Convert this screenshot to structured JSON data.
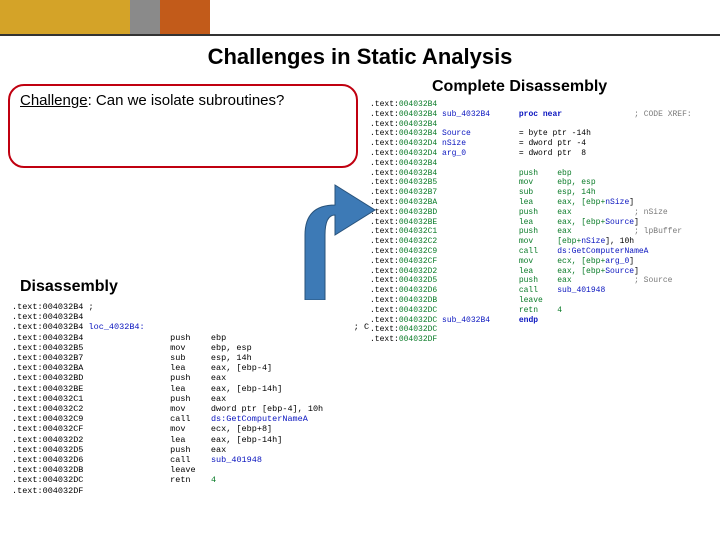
{
  "title": "Challenges in Static Analysis",
  "challenge_prefix": "Challenge",
  "challenge_rest": ": Can we isolate subroutines?",
  "right_heading": "Complete Disassembly",
  "left_heading": "Disassembly",
  "code_left": {
    "l01": ".text:004032B4 ;",
    "l02": ".text:004032B4",
    "l03a": ".text:004032B4 ",
    "l03b": "loc_4032B4:",
    "l03c": "                                         ; C",
    "l04": ".text:004032B4                 push    ebp",
    "l05": ".text:004032B5                 mov     ebp, esp",
    "l06": ".text:004032B7                 sub     esp, 14h",
    "l07": ".text:004032BA                 lea     eax, [ebp-4]",
    "l08": ".text:004032BD                 push    eax",
    "l09": ".text:004032BE                 lea     eax, [ebp-14h]",
    "l10": ".text:004032C1                 push    eax",
    "l11": ".text:004032C2                 mov     dword ptr [ebp-4], 10h",
    "l12a": ".text:004032C9                 call    ",
    "l12b": "ds:GetComputerNameA",
    "l13": ".text:004032CF                 mov     ecx, [ebp+8]",
    "l14": ".text:004032D2                 lea     eax, [ebp-14h]",
    "l15": ".text:004032D5                 push    eax",
    "l16a": ".text:004032D6                 call    ",
    "l16b": "sub_401948",
    "l17": ".text:004032DB                 leave",
    "l18a": ".text:004032DC                 retn    ",
    "l18b": "4",
    "l19": ".text:004032DF"
  },
  "code_right": {
    "l01a": ".text:",
    "l01b": "004032B4",
    "l02a": ".text:",
    "l02b": "004032B4 ",
    "l02c": "sub_4032B4",
    "l02d": "      ",
    "l02e": "proc near",
    "l02f": "               ",
    "l02g": "; CODE XREF:",
    "l03a": ".text:",
    "l03b": "004032B4",
    "l04a": ".text:",
    "l04b": "004032B4 ",
    "l04c": "Source",
    "l04d": "          = byte ptr -14h",
    "l05a": ".text:",
    "l05b": "004032D4 ",
    "l05c": "nSize",
    "l05d": "           = dword ptr -4",
    "l06a": ".text:",
    "l06b": "004032D4 ",
    "l06c": "arg_0",
    "l06d": "           = dword ptr  8",
    "l07a": ".text:",
    "l07b": "004032B4",
    "l08a": ".text:",
    "l08b": "004032B4                 push    ebp",
    "l09a": ".text:",
    "l09b": "004032B5                 mov     ebp, esp",
    "l10a": ".text:",
    "l10b": "004032B7                 sub     esp, 14h",
    "l11a": ".text:",
    "l11b": "004032BA                 lea     eax, [ebp+",
    "l11c": "nSize",
    "l11d": "]",
    "l12a": ".text:",
    "l12b": "004032BD                 push    eax             ",
    "l12c": "; nSize",
    "l13a": ".text:",
    "l13b": "004032BE                 lea     eax, [ebp+",
    "l13c": "Source",
    "l13d": "]",
    "l14a": ".text:",
    "l14b": "004032C1                 push    eax             ",
    "l14c": "; lpBuffer",
    "l15a": ".text:",
    "l15b": "004032C2                 mov     [ebp+",
    "l15c": "nSize",
    "l15d": "], 10h",
    "l16a": ".text:",
    "l16b": "004032C9                 call    ",
    "l16c": "ds:GetComputerNameA",
    "l17a": ".text:",
    "l17b": "004032CF                 mov     ecx, [ebp+",
    "l17c": "arg_0",
    "l17d": "]",
    "l18a": ".text:",
    "l18b": "004032D2                 lea     eax, [ebp+",
    "l18c": "Source",
    "l18d": "]",
    "l19a": ".text:",
    "l19b": "004032D5                 push    eax             ",
    "l19c": "; Source",
    "l20a": ".text:",
    "l20b": "004032D6                 call    ",
    "l20c": "sub_401948",
    "l21a": ".text:",
    "l21b": "004032DB                 leave",
    "l22a": ".text:",
    "l22b": "004032DC                 retn    ",
    "l22c": "4",
    "l23a": ".text:",
    "l23b": "004032DC ",
    "l23c": "sub_4032B4",
    "l23d": "      ",
    "l23e": "endp",
    "l24a": ".text:",
    "l24b": "004032DC",
    "l25a": ".text:",
    "l25b": "004032DF"
  }
}
